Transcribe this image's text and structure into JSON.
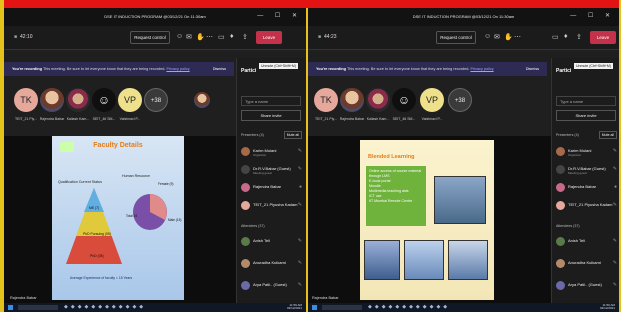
{
  "window_title": "DSE IT INDUCTION PROGRAM @03/12/21 On 11:30am",
  "left": {
    "timer": "42:10",
    "request_control": "Request control",
    "leave": "Leave",
    "banner_bold": "You're recording",
    "banner_text": "This meeting. Be sure to let everyone know that they are being recorded.",
    "banner_link": "Privacy policy",
    "dismiss": "Dismiss",
    "avatars": [
      {
        "initials": "TK",
        "label": "TEIT_21 Piy..."
      },
      {
        "initials": "",
        "label": "Rajendra Babar"
      },
      {
        "initials": "",
        "label": "Kailash Kam..."
      },
      {
        "initials": "",
        "label": "SEIT_46 SM..."
      },
      {
        "initials": "VP",
        "label": "Vaishnavi P..."
      },
      {
        "initials": "+38",
        "label": ""
      }
    ],
    "slide_title": "Faculty Details",
    "slide_labels": {
      "qual": "Qualification Current Status",
      "hr": "Human Resource",
      "female": "Female (9)",
      "total": "Total 24",
      "male": "Male (15)",
      "me": "ME (7)",
      "phd_pursuing": "PhD Pursuing (05)",
      "phd": "PhD (08)",
      "avg": "Average Experience of faculty = 15 Years"
    },
    "speaker": "Rajendra Babar"
  },
  "right": {
    "timer": "44:23",
    "request_control": "Request control",
    "leave": "Leave",
    "banner_bold": "You're recording",
    "banner_text": "This meeting. Be sure to let everyone know that they are being recorded.",
    "banner_link": "Privacy policy",
    "dismiss": "Dismiss",
    "avatars": [
      {
        "initials": "TK",
        "label": "TEIT_21 Piy..."
      },
      {
        "initials": "",
        "label": "Rajendra Babar"
      },
      {
        "initials": "",
        "label": "Kailash Kam..."
      },
      {
        "initials": "",
        "label": "SEIT_46 SM..."
      },
      {
        "initials": "VP",
        "label": "Vaishnavi P..."
      },
      {
        "initials": "+38",
        "label": ""
      }
    ],
    "slide_title": "Blended Learning",
    "bullets": [
      "Online access of course material through LMS",
      "E-book portal",
      "Moodle",
      "Multimedia teaching aids",
      "ICT use",
      "IIT Mumbai Remote Centre"
    ],
    "speaker": "Rajendra Babar",
    "panel": {
      "title": "Partici",
      "tooltip": "Unmute (Ctrl+Shift+M)",
      "type_name": "Type a name",
      "share_invite": "Share invite",
      "presenters": "Presenters (4)",
      "mute_all": "Mute all",
      "presenter_list": [
        {
          "name": "Karim Mulani",
          "role": "Organizer"
        },
        {
          "name": "Dr.R.V.Babar (Guest)",
          "role": "Meeting guest"
        },
        {
          "name": "Rajendra Babar",
          "role": ""
        },
        {
          "name": "TEIT_21 Piyusha Kadam",
          "role": ""
        }
      ],
      "attendees": "Attendees (37)",
      "attendee_list": [
        {
          "name": "Anish Teli",
          "role": ""
        },
        {
          "name": "Anuradha Kulkarni",
          "role": ""
        },
        {
          "name": "Arya Patil.. (Guest)",
          "role": ""
        }
      ]
    }
  },
  "left_panel": {
    "title": "Partici",
    "tooltip": "Unmute (Ctrl+Shift+M)",
    "type_name": "Type a name",
    "share_invite": "Share invite",
    "presenters": "Presenters (4)",
    "mute_all": "Mute all",
    "presenter_list": [
      {
        "name": "Karim Mulani",
        "role": "Organizer"
      },
      {
        "name": "Dr.R.V.Babar (Guest)",
        "role": "Meeting guest"
      },
      {
        "name": "Rajendra Babar",
        "role": ""
      },
      {
        "name": "TEIT_21 Piyusha Kadam",
        "role": ""
      }
    ],
    "attendees": "Attendees (37)",
    "attendee_list": [
      {
        "name": "Anish Teli",
        "role": ""
      },
      {
        "name": "Anuradha Kulkarni",
        "role": ""
      },
      {
        "name": "Arya Patil.. (Guest)",
        "role": ""
      }
    ]
  },
  "clock_time": "11:59 AM",
  "clock_date": "03/12/2021",
  "colors": {
    "leave": "#c4314b",
    "banner": "#2d2b54",
    "accent": "#e31313",
    "border": "#e3c21c"
  }
}
